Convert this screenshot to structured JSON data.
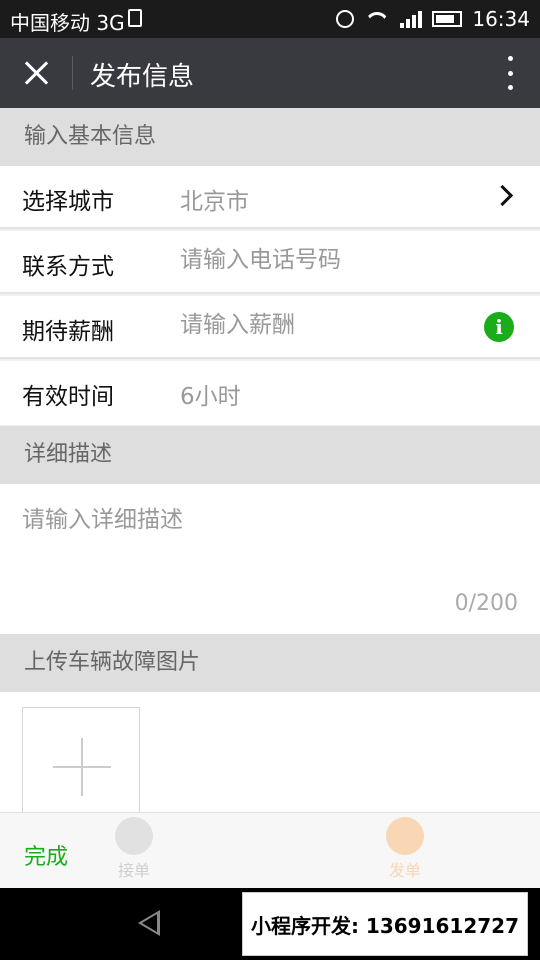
{
  "status_bar": {
    "carrier": "中国移动 3G",
    "time": "16:34"
  },
  "header": {
    "title": "发布信息"
  },
  "sections": {
    "basic_info": "输入基本信息",
    "details": "详细描述",
    "upload": "上传车辆故障图片"
  },
  "form": {
    "city": {
      "label": "选择城市",
      "value": "北京市"
    },
    "contact": {
      "label": "联系方式",
      "placeholder": "请输入电话号码"
    },
    "salary": {
      "label": "期待薪酬",
      "placeholder": "请输入薪酬",
      "info_glyph": "i"
    },
    "duration": {
      "label": "有效时间",
      "value": "6小时"
    }
  },
  "description": {
    "placeholder": "请输入详细描述",
    "counter": "0/200"
  },
  "actions": {
    "done": "完成"
  },
  "tabs": {
    "take_order": "接单",
    "send_order": "发单"
  },
  "watermark": "小程序开发: 13691612727",
  "colors": {
    "accent": "#1aad19",
    "header_bg": "#393a3f",
    "section_bg": "#dedede"
  }
}
